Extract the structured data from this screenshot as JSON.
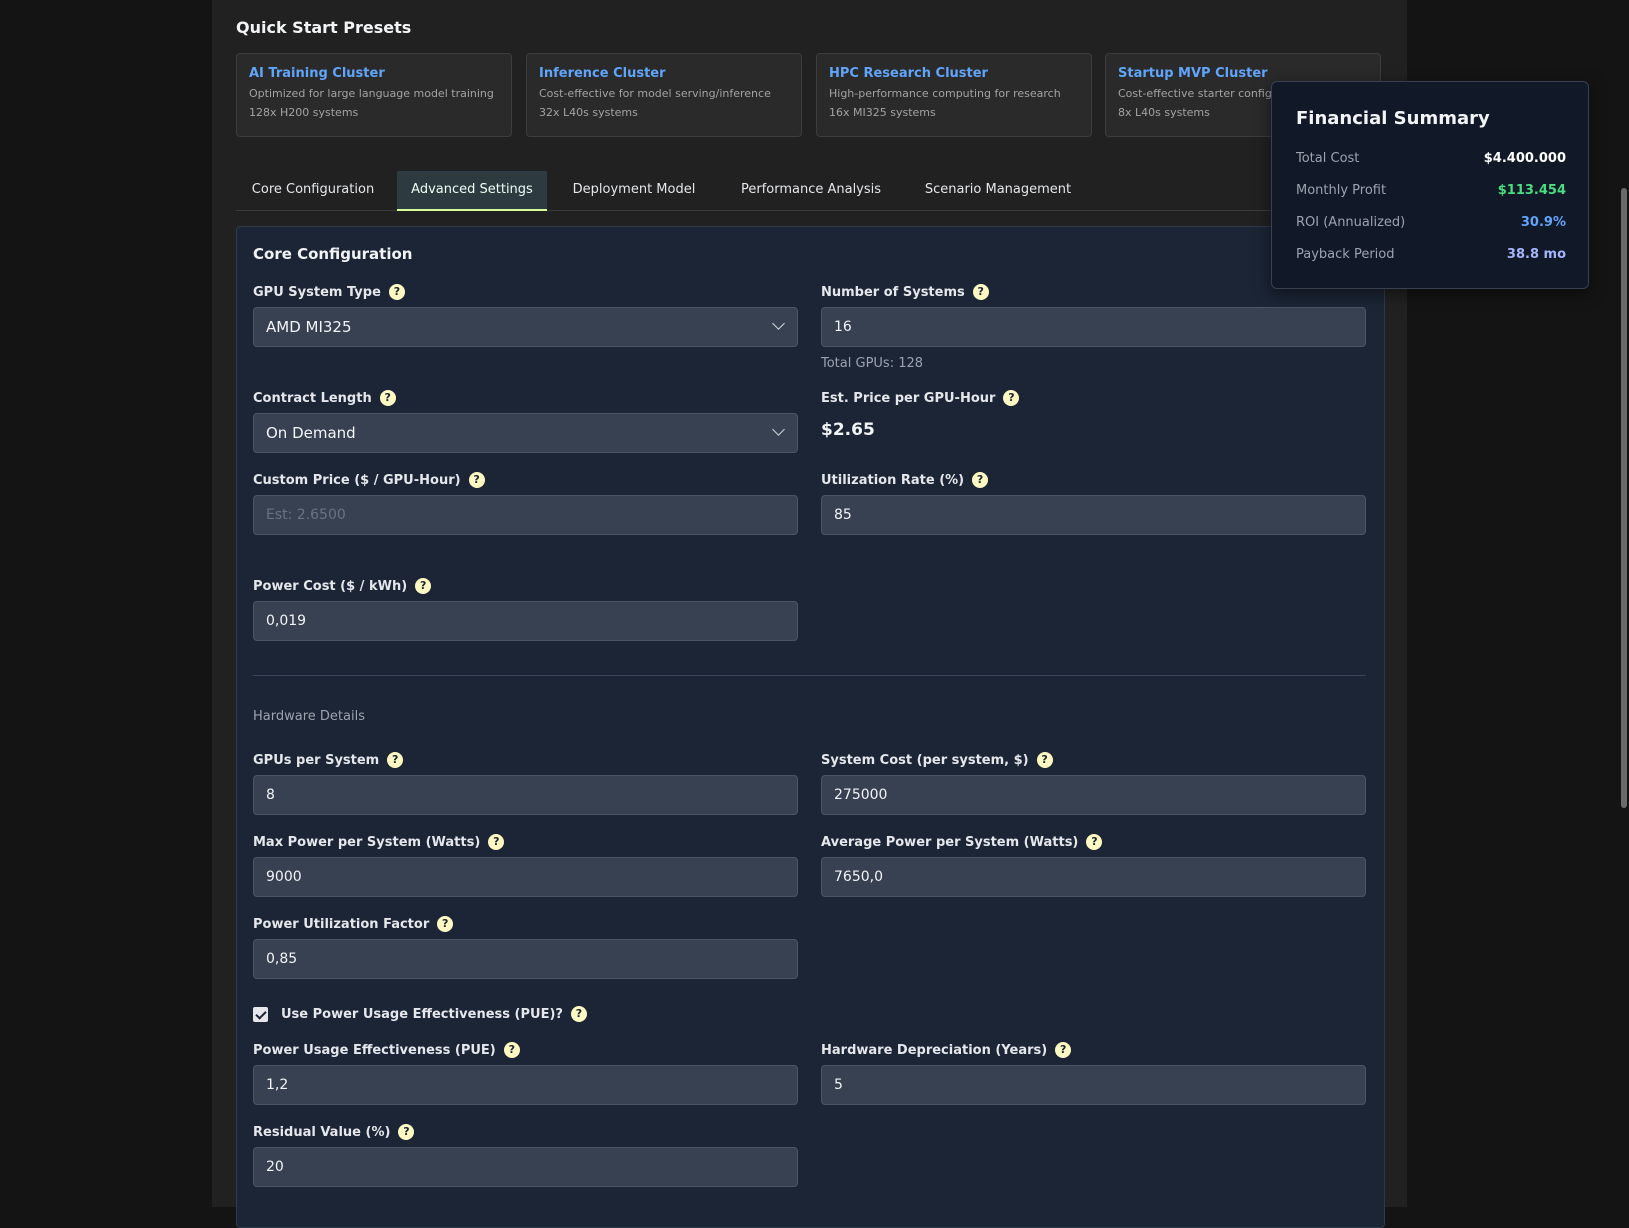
{
  "quick_start": {
    "title": "Quick Start Presets",
    "presets": [
      {
        "title": "AI Training Cluster",
        "desc": "Optimized for large language model training",
        "count": "128x H200 systems"
      },
      {
        "title": "Inference Cluster",
        "desc": "Cost-effective for model serving/inference",
        "count": "32x L40s systems"
      },
      {
        "title": "HPC Research Cluster",
        "desc": "High-performance computing for research",
        "count": "16x MI325 systems"
      },
      {
        "title": "Startup MVP Cluster",
        "desc": "Cost-effective starter configu",
        "count": "8x L40s systems"
      }
    ]
  },
  "tabs": [
    {
      "label": "Core Configuration",
      "active": false
    },
    {
      "label": "Advanced Settings",
      "active": true
    },
    {
      "label": "Deployment Model",
      "active": false
    },
    {
      "label": "Performance Analysis",
      "active": false
    },
    {
      "label": "Scenario Management",
      "active": false
    }
  ],
  "help_icon": "?",
  "core": {
    "title": "Core Configuration",
    "gpu_system_type": {
      "label": "GPU System Type",
      "value": "AMD MI325"
    },
    "num_systems": {
      "label": "Number of Systems",
      "value": "16",
      "hint": "Total GPUs: 128"
    },
    "contract_length": {
      "label": "Contract Length",
      "value": "On Demand"
    },
    "est_price": {
      "label": "Est. Price per GPU-Hour",
      "value": "$2.65"
    },
    "custom_price": {
      "label": "Custom Price ($ / GPU-Hour)",
      "placeholder": "Est: 2.6500"
    },
    "utilization": {
      "label": "Utilization Rate (%)",
      "value": "85"
    },
    "power_cost": {
      "label": "Power Cost ($ / kWh)",
      "value": "0,019"
    }
  },
  "hardware": {
    "title": "Hardware Details",
    "gpus_per_system": {
      "label": "GPUs per System",
      "value": "8"
    },
    "system_cost": {
      "label": "System Cost (per system, $)",
      "value": "275000"
    },
    "max_power": {
      "label": "Max Power per System (Watts)",
      "value": "9000"
    },
    "avg_power": {
      "label": "Average Power per System (Watts)",
      "value": "7650,0"
    },
    "power_util_factor": {
      "label": "Power Utilization Factor",
      "value": "0,85"
    },
    "use_pue": {
      "label": "Use Power Usage Effectiveness (PUE)?",
      "checked": true
    },
    "pue": {
      "label": "Power Usage Effectiveness (PUE)",
      "value": "1,2"
    },
    "depreciation": {
      "label": "Hardware Depreciation (Years)",
      "value": "5"
    },
    "residual": {
      "label": "Residual Value (%)",
      "value": "20"
    }
  },
  "summary": {
    "title": "Financial Summary",
    "rows": [
      {
        "label": "Total Cost",
        "value": "$4.400.000",
        "color": "#ffffff"
      },
      {
        "label": "Monthly Profit",
        "value": "$113.454",
        "color": "#4ade80"
      },
      {
        "label": "ROI (Annualized)",
        "value": "30.9%",
        "color": "#60a5fa"
      },
      {
        "label": "Payback Period",
        "value": "38.8 mo",
        "color": "#a5b4fc"
      }
    ]
  }
}
